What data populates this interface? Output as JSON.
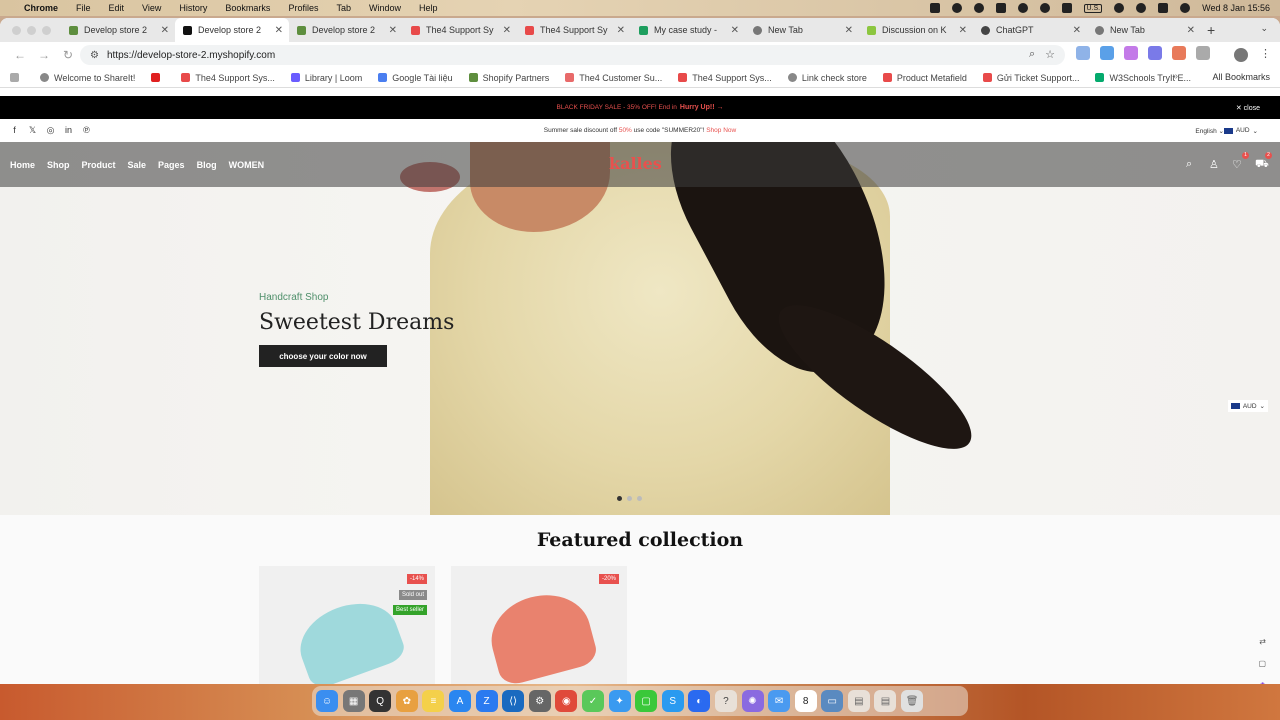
{
  "menubar": {
    "items": [
      "Chrome",
      "File",
      "Edit",
      "View",
      "History",
      "Bookmarks",
      "Profiles",
      "Tab",
      "Window",
      "Help"
    ],
    "input_source": "U.S.",
    "clock": "Wed 8 Jan  15:56"
  },
  "browser": {
    "tabs": [
      {
        "title": "Develop store 2",
        "favicon_color": "#5e8e3e"
      },
      {
        "title": "Develop store 2",
        "favicon_color": "#111111",
        "active": true
      },
      {
        "title": "Develop store 2",
        "favicon_color": "#5e8e3e"
      },
      {
        "title": "The4 Support Sy",
        "favicon_color": "#e84a4a"
      },
      {
        "title": "The4 Support Sy",
        "favicon_color": "#e84a4a"
      },
      {
        "title": "My case study -",
        "favicon_color": "#1e9e5e"
      },
      {
        "title": "New Tab",
        "favicon_color": "#777777"
      },
      {
        "title": "Discussion on K",
        "favicon_color": "#8cc63f"
      },
      {
        "title": "ChatGPT",
        "favicon_color": "#444444"
      },
      {
        "title": "New Tab",
        "favicon_color": "#777777"
      }
    ],
    "url": "https://develop-store-2.myshopify.com",
    "bookmarks": [
      {
        "label": "Welcome to ShareIt!",
        "color": "#888888"
      },
      {
        "label": "",
        "color": "#e02020"
      },
      {
        "label": "The4 Support Sys...",
        "color": "#e84a4a"
      },
      {
        "label": "Library | Loom",
        "color": "#6a5cff"
      },
      {
        "label": "Google Tài liệu",
        "color": "#4a7ef0"
      },
      {
        "label": "Shopify Partners",
        "color": "#5e8e3e"
      },
      {
        "label": "The4 Customer Su...",
        "color": "#e86a6a"
      },
      {
        "label": "The4 Support Sys...",
        "color": "#e84a4a"
      },
      {
        "label": "Link check store",
        "color": "#888888"
      },
      {
        "label": "Product Metafield",
        "color": "#e84a4a"
      },
      {
        "label": "Gửi Ticket Support...",
        "color": "#e84a4a"
      },
      {
        "label": "W3Schools TryIt E...",
        "color": "#04aa6d"
      }
    ],
    "all_bookmarks": "All Bookmarks"
  },
  "store": {
    "promo": {
      "text": "BLACK FRIDAY SALE - 35% OFF! End in",
      "link": "Hurry Up!! →",
      "close": "close"
    },
    "topbar": {
      "summer_pre": "Summer sale discount off",
      "summer_pct": "50%",
      "summer_post": "use code \"SUMMER20\"!",
      "shop_now": "Shop Now",
      "language": "English",
      "currency": "AUD"
    },
    "nav": {
      "links": [
        "Home",
        "Shop",
        "Product",
        "Sale",
        "Pages",
        "Blog",
        "WOMEN"
      ],
      "logo": "kalles",
      "wishlist_count": "1",
      "cart_count": "2"
    },
    "hero": {
      "subtitle": "Handcraft Shop",
      "title": "Sweetest Dreams",
      "cta": "choose your color now",
      "side_currency": "AUD"
    },
    "featured": {
      "title": "Featured collection",
      "products": [
        {
          "badges": [
            {
              "text": "-14%",
              "color": "#e8514e"
            },
            {
              "text": "Sold out",
              "color": "#8a8a8a"
            },
            {
              "text": "Best seller",
              "color": "#34a32a"
            }
          ]
        },
        {
          "badges": [
            {
              "text": "-20%",
              "color": "#e8514e"
            }
          ]
        }
      ]
    }
  },
  "colors": {
    "accent": "#e8514e",
    "brand_green": "#4e8f6a"
  }
}
